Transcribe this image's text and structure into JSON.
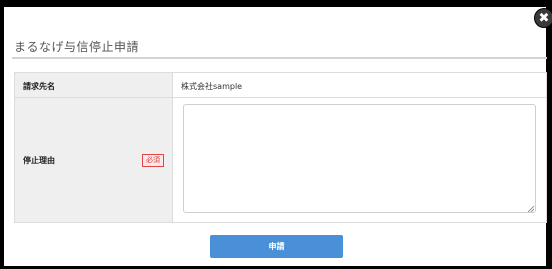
{
  "modal": {
    "title": "まるなげ与信停止申請",
    "close_icon": "close-icon",
    "close_glyph": "✖"
  },
  "form": {
    "rows": [
      {
        "label": "請求先名",
        "value": "株式会社sample"
      },
      {
        "label": "停止理由",
        "required_badge": "必須",
        "textarea_value": ""
      }
    ]
  },
  "actions": {
    "submit_label": "申請"
  },
  "colors": {
    "accent": "#4a90d9",
    "required": "#d63c3c",
    "label_bg": "#efefef",
    "backdrop": "#000000"
  }
}
